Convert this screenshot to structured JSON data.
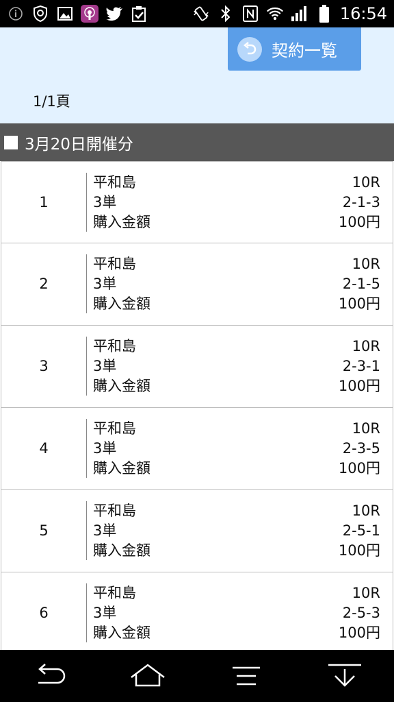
{
  "status_bar": {
    "time": "16:54",
    "left_icons": [
      "info-icon",
      "security-icon",
      "image-icon",
      "podcast-icon",
      "twitter-icon",
      "clipboard-icon"
    ],
    "right_icons": [
      "vibrate-icon",
      "bluetooth-icon",
      "nfc-icon",
      "wifi-icon",
      "signal-icon",
      "battery-icon"
    ]
  },
  "header": {
    "contract_button_label": "契約一覧",
    "pager": "1/1頁"
  },
  "section": {
    "title": "3月20日開催分"
  },
  "labels": {
    "venue_label": "平和島",
    "bet_type_label": "3単",
    "amount_label": "購入金額"
  },
  "rows": [
    {
      "number": "1",
      "venue": "平和島",
      "bet_type": "3単",
      "amount_label": "購入金額",
      "race": "10R",
      "combination": "2-1-3",
      "amount": "100円"
    },
    {
      "number": "2",
      "venue": "平和島",
      "bet_type": "3単",
      "amount_label": "購入金額",
      "race": "10R",
      "combination": "2-1-5",
      "amount": "100円"
    },
    {
      "number": "3",
      "venue": "平和島",
      "bet_type": "3単",
      "amount_label": "購入金額",
      "race": "10R",
      "combination": "2-3-1",
      "amount": "100円"
    },
    {
      "number": "4",
      "venue": "平和島",
      "bet_type": "3単",
      "amount_label": "購入金額",
      "race": "10R",
      "combination": "2-3-5",
      "amount": "100円"
    },
    {
      "number": "5",
      "venue": "平和島",
      "bet_type": "3単",
      "amount_label": "購入金額",
      "race": "10R",
      "combination": "2-5-1",
      "amount": "100円"
    },
    {
      "number": "6",
      "venue": "平和島",
      "bet_type": "3単",
      "amount_label": "購入金額",
      "race": "10R",
      "combination": "2-5-3",
      "amount": "100円"
    }
  ],
  "nav_bar": {
    "icons": [
      "back-icon",
      "home-icon",
      "menu-icon",
      "notification-pull-icon"
    ]
  },
  "colors": {
    "accent": "#5b9ee8",
    "header_bg": "#e3f2ff",
    "section_bg": "#575757"
  }
}
